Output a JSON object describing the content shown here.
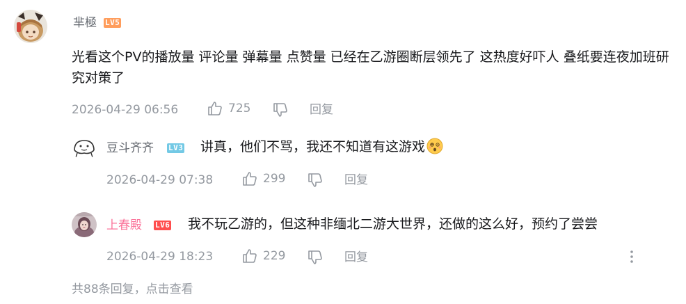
{
  "colors": {
    "lv5": "#ff9d5c",
    "lv3": "#73c9e5",
    "lv6": "#ff4e4e",
    "vip_name": "#fb7299",
    "normal_name": "#61666d",
    "meta": "#9499a0"
  },
  "main_comment": {
    "username": "芈極",
    "level": "LV5",
    "text": "光看这个PV的播放量 评论量 弹幕量 点赞量 已经在乙游圈断层领先了 这热度好吓人 叠纸要连夜加班研究对策了",
    "time": "2026-04-29 06:56",
    "likes": "725",
    "reply_label": "回复",
    "avatar_icon": "anime-avatar-icon"
  },
  "replies": [
    {
      "username": "豆斗齐齐",
      "level": "LV3",
      "text": "讲真，他们不骂，我还不知道有这游戏",
      "emoji": "dizzy-face-emoji",
      "time": "2026-04-29 07:38",
      "likes": "299",
      "reply_label": "回复",
      "avatar_icon": "doodle-avatar-icon"
    },
    {
      "username": "上春殿",
      "level": "LV6",
      "text": "我不玩乙游的，但这种非缅北二游大世界，还做的这么好，预约了尝尝",
      "time": "2026-04-29 18:23",
      "likes": "229",
      "reply_label": "回复",
      "avatar_icon": "portrait-avatar-icon"
    }
  ],
  "footer": {
    "summary": "共88条回复，点击查看"
  }
}
